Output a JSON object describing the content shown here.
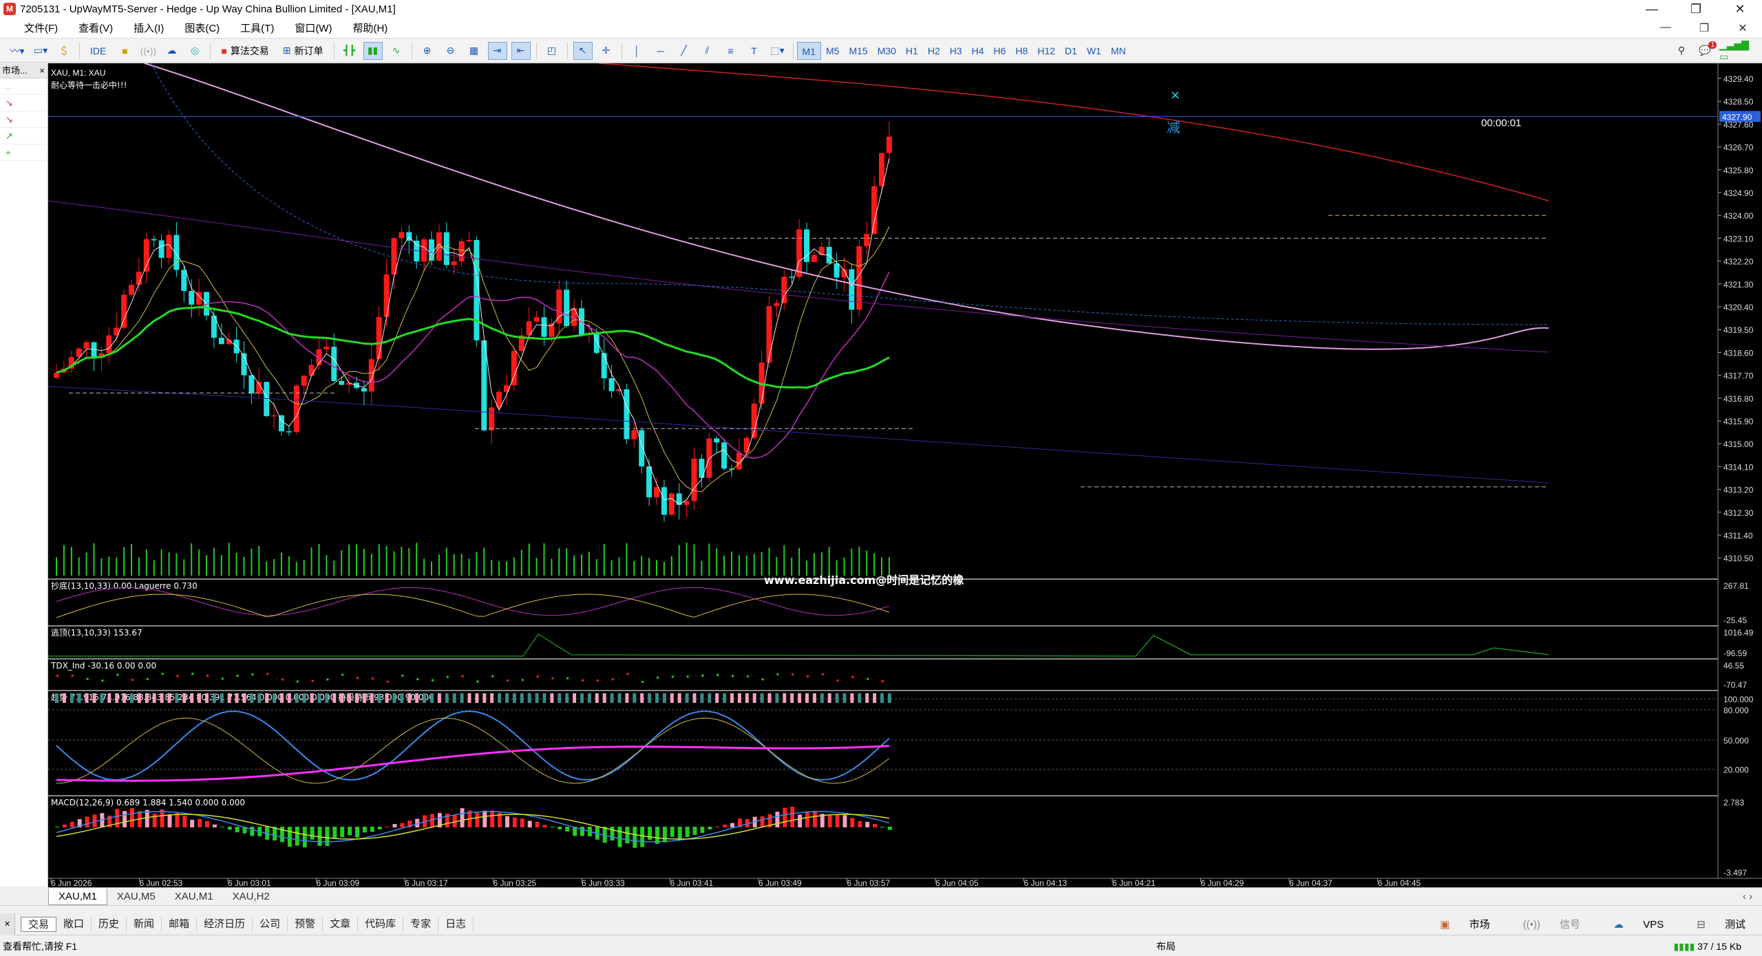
{
  "window": {
    "title": "7205131 - UpWayMT5-Server - Hedge - Up Way China Bullion Limited - [XAU,M1]",
    "min": "—",
    "restore": "❐",
    "close": "✕"
  },
  "menu": [
    "文件(F)",
    "查看(V)",
    "插入(I)",
    "图表(C)",
    "工具(T)",
    "窗口(W)",
    "帮助(H)"
  ],
  "toolbar": {
    "ide": "IDE",
    "algo": "算法交易",
    "neworder": "新订单",
    "timeframes": [
      "M1",
      "M5",
      "M15",
      "M30",
      "H1",
      "H2",
      "H3",
      "H4",
      "H6",
      "H8",
      "H12",
      "D1",
      "W1",
      "MN"
    ],
    "active_tf": "M1",
    "notif": "1"
  },
  "market_watch": {
    "title": "市场...",
    "close": "×",
    "rows": [
      "..",
      "↘",
      "↘",
      "↗",
      "+"
    ]
  },
  "chart": {
    "symbol_label": "XAU, M1:  XAU",
    "comment": "耐心等待一击必中!!!",
    "price_axis": [
      "4329.40",
      "4328.50",
      "4327.60",
      "4326.70",
      "4325.80",
      "4324.90",
      "4324.00",
      "4323.10",
      "4322.20",
      "4321.30",
      "4320.40",
      "4319.50",
      "4318.60",
      "4317.70",
      "4316.80",
      "4315.90",
      "4315.00",
      "4314.10",
      "4313.20",
      "4312.30",
      "4311.40",
      "4310.50"
    ],
    "current_price": "4327.90",
    "countdown": "00:00:01",
    "annot_x": "×",
    "annot_text": "减",
    "watermark": "www.eazhijia.com@时间是记忆的橡",
    "time_axis": [
      "6 Jun 2026",
      "6 Jun 02:53",
      "6 Jun 03:01",
      "6 Jun 03:09",
      "6 Jun 03:17",
      "6 Jun 03:25",
      "6 Jun 03:33",
      "6 Jun 03:41",
      "6 Jun 03:49",
      "6 Jun 03:57",
      "6 Jun 04:05",
      "6 Jun 04:13",
      "6 Jun 04:21",
      "6 Jun 04:29",
      "6 Jun 04:37",
      "6 Jun 04:45"
    ],
    "sub1": {
      "label": "抄底(13,10,33) 0.00 Laguerre 0.730",
      "top": "267.81",
      "bottom": "-25.45"
    },
    "sub2": {
      "label": "逃顶(13,10,33) 153.67",
      "top": "1016.49",
      "bottom": "-96.59"
    },
    "sub3": {
      "label": "TDX_Ind -30.16 0.00 0.00",
      "top": "46.55",
      "bottom": "-70.47"
    },
    "sub4": {
      "label": "趋势 71.916 71.916 88.843 85.234 80.391 71.564 0.000 0.000 0.000 持股持币 93.000 90.000",
      "levels": [
        "100.000",
        "80.000",
        "50.000",
        "20.000"
      ]
    },
    "sub5": {
      "label": "MACD(12,26,9) 0.689 1.884 1.540 0.000 0.000",
      "top": "2.783",
      "bottom": "-3.497"
    }
  },
  "chart_tabs": [
    "XAU,M1",
    "XAU,M5",
    "XAU,M1",
    "XAU,H2"
  ],
  "terminal_tabs": [
    "交易",
    "敞口",
    "历史",
    "新闻",
    "邮箱",
    "经济日历",
    "公司",
    "预警",
    "文章",
    "代码库",
    "专家",
    "日志"
  ],
  "terminal_right": [
    "市场",
    "信号",
    "VPS",
    "测试"
  ],
  "status": {
    "help": "查看帮忙,请按 F1",
    "profile": "布局",
    "traffic": "37 / 15 Kb"
  },
  "colors": {
    "bull": "#ff1a1a",
    "bear": "#22e0e0",
    "bg": "#000000",
    "volume": "#22cc22"
  }
}
